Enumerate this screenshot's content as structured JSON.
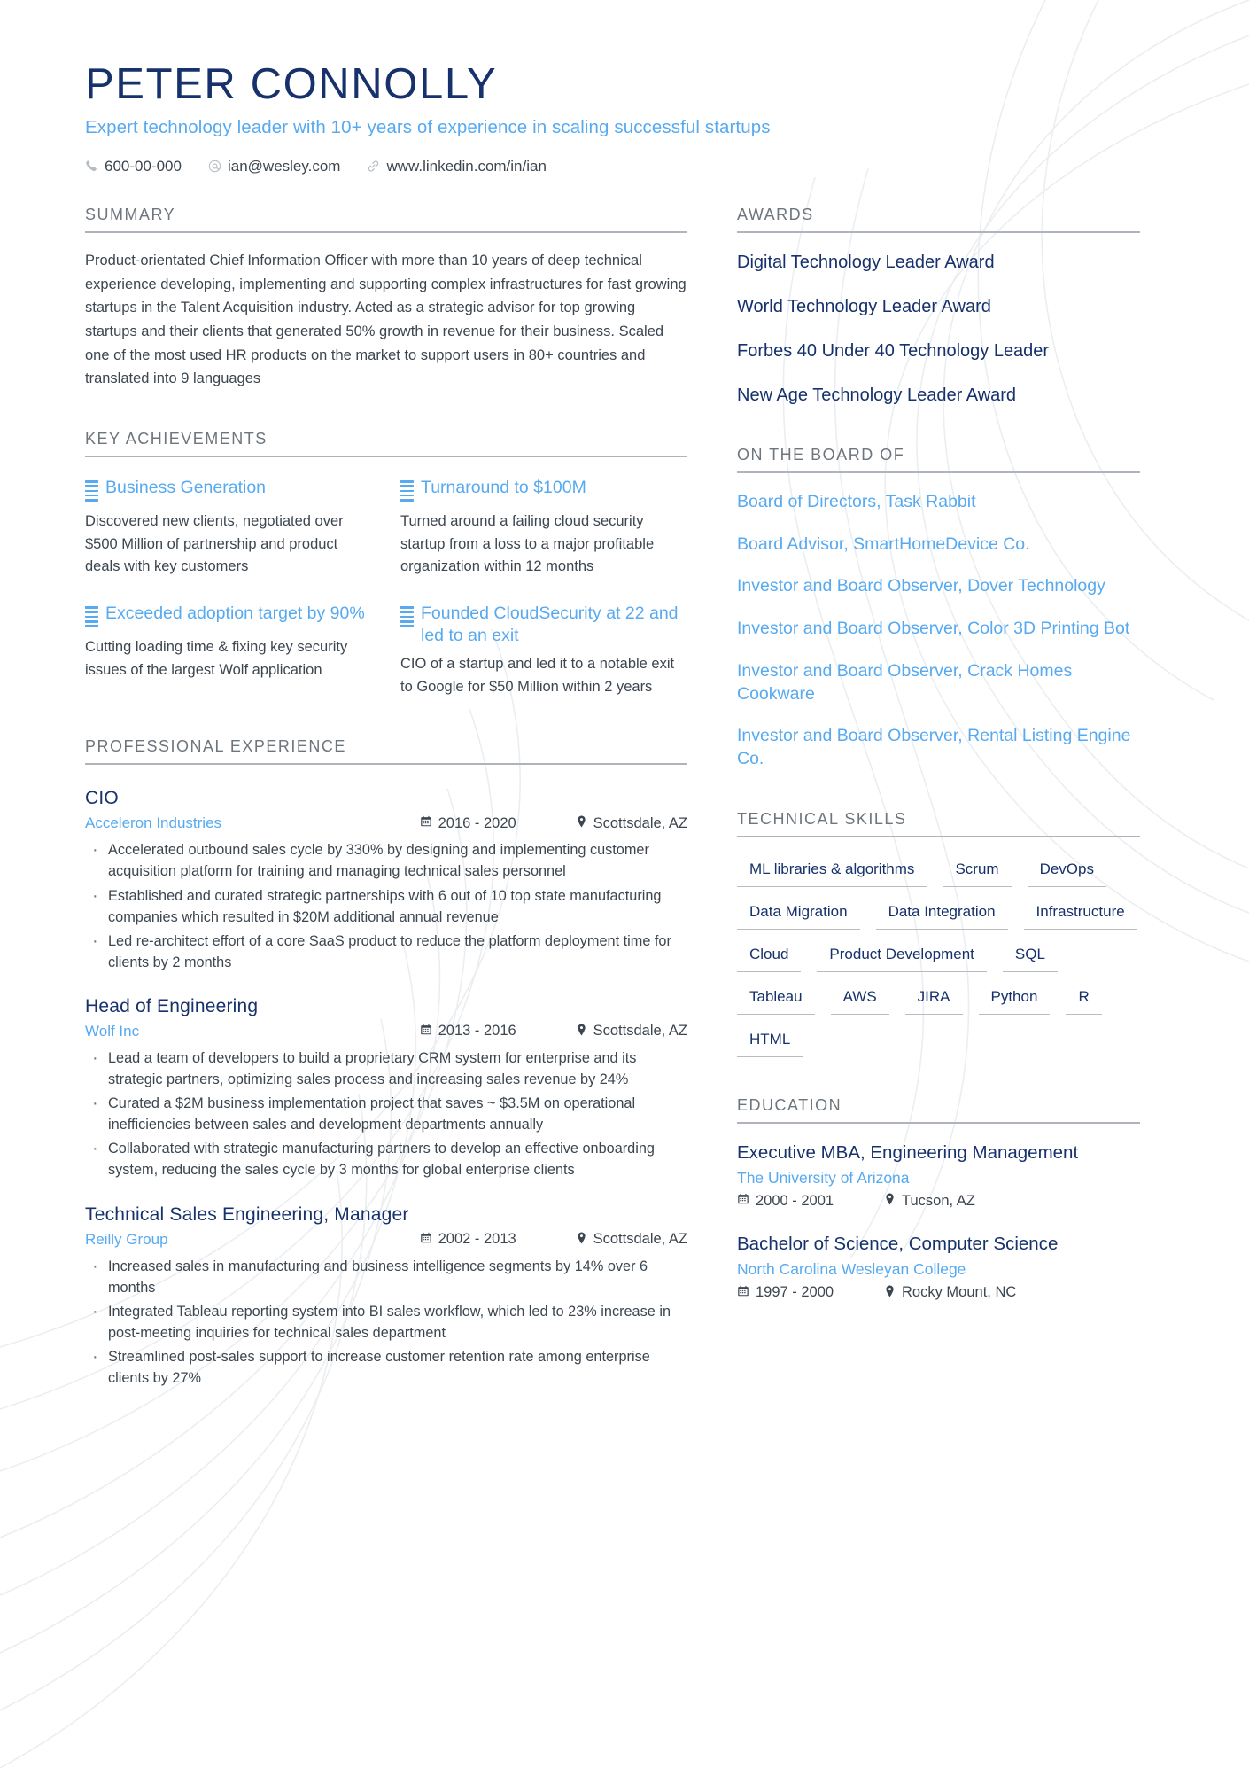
{
  "header": {
    "name": "PETER CONNOLLY",
    "headline": "Expert technology leader with 10+ years of experience in scaling successful startups",
    "contacts": [
      {
        "icon": "phone-icon",
        "glyph": "✆",
        "value": "600-00-000"
      },
      {
        "icon": "email-icon",
        "glyph": "@",
        "value": "ian@wesley.com"
      },
      {
        "icon": "link-icon",
        "glyph": "⚭",
        "value": "www.linkedin.com/in/ian"
      }
    ]
  },
  "sections": {
    "summary_title": "SUMMARY",
    "key_achievements_title": "KEY ACHIEVEMENTS",
    "experience_title": "PROFESSIONAL EXPERIENCE",
    "awards_title": "AWARDS",
    "board_title": "ON THE BOARD OF",
    "skills_title": "TECHNICAL SKILLS",
    "education_title": "EDUCATION"
  },
  "summary": {
    "text": "Product-orientated Chief Information Officer with more than 10 years of deep technical experience developing, implementing and supporting complex infrastructures for fast growing startups in the Talent Acquisition industry. Acted as a strategic advisor for top growing startups and their clients that generated 50% growth in revenue for their business. Scaled one of the most used HR products on the market to support users in 80+ countries and translated into 9 languages"
  },
  "key_achievements": [
    {
      "title": "Business Generation",
      "desc": "Discovered new clients, negotiated over $500 Million of partnership and product deals with key customers"
    },
    {
      "title": "Turnaround to $100M",
      "desc": "Turned around a failing cloud security startup from a loss to a major profitable organization within 12 months"
    },
    {
      "title": "Exceeded adoption target by 90%",
      "desc": "Cutting loading time & fixing key security issues of the largest Wolf application"
    },
    {
      "title": "Founded CloudSecurity at 22 and led to an exit",
      "desc": "CIO of a startup and led it to a notable exit to Google for $50 Million within 2 years"
    }
  ],
  "experience": [
    {
      "title": "CIO",
      "company": "Acceleron Industries",
      "dates": "2016 - 2020",
      "location": "Scottsdale, AZ",
      "bullets": [
        "Accelerated outbound sales cycle by 330% by designing and implementing customer acquisition platform for training and managing technical sales personnel",
        "Established and curated strategic partnerships with 6 out of 10 top state manufacturing companies which resulted in $20M additional annual revenue",
        "Led re-architect effort of a core SaaS product to reduce the platform deployment time for clients by 2 months"
      ]
    },
    {
      "title": "Head of Engineering",
      "company": "Wolf Inc",
      "dates": "2013 - 2016",
      "location": "Scottsdale, AZ",
      "bullets": [
        "Lead a team of developers to build a proprietary CRM system for enterprise and its strategic partners, optimizing sales process and increasing sales revenue by 24%",
        "Curated a $2M business implementation project that saves ~ $3.5M on operational inefficiencies between sales and development departments annually",
        "Collaborated with strategic manufacturing partners to develop an effective onboarding system, reducing the sales cycle by 3 months for global enterprise clients"
      ]
    },
    {
      "title": "Technical Sales Engineering, Manager",
      "company": "Reilly Group",
      "dates": "2002 - 2013",
      "location": "Scottsdale, AZ",
      "bullets": [
        "Increased sales in manufacturing and business intelligence segments by 14% over 6 months",
        "Integrated Tableau reporting system into BI sales workflow, which led to 23% increase in post-meeting inquiries for technical sales department",
        "Streamlined post-sales support to increase customer retention rate among enterprise clients by 27%"
      ]
    }
  ],
  "awards": [
    "Digital Technology Leader Award",
    "World Technology Leader Award",
    "Forbes 40 Under 40 Technology Leader",
    "New Age Technology Leader Award"
  ],
  "board": [
    "Board of Directors, Task Rabbit",
    "Board Advisor, SmartHomeDevice Co.",
    "Investor and Board Observer, Dover Technology",
    "Investor and Board Observer, Color 3D Printing Bot",
    "Investor and Board Observer, Crack Homes Cookware",
    "Investor and Board Observer, Rental Listing Engine Co."
  ],
  "skills": [
    "ML libraries & algorithms",
    "Scrum",
    "DevOps",
    "Data Migration",
    "Data Integration",
    "Infrastructure",
    "Cloud",
    "Product Development",
    "SQL",
    "Tableau",
    "AWS",
    "JIRA",
    "Python",
    "R",
    "HTML"
  ],
  "education": [
    {
      "degree": "Executive MBA, Engineering Management",
      "school": "The University of Arizona",
      "dates": "2000 - 2001",
      "location": "Tucson, AZ"
    },
    {
      "degree": "Bachelor of Science, Computer Science",
      "school": "North Carolina Wesleyan College",
      "dates": "1997 - 2000",
      "location": "Rocky Mount, NC"
    }
  ],
  "icons": {
    "calendar": "Ὄ5",
    "pin": "•"
  },
  "colors": {
    "navy": "#16316b",
    "light_blue": "#57aaf0",
    "body_text": "#3c4650",
    "heading_gray": "#6d757d",
    "rule_gray": "#aeb4ba"
  }
}
